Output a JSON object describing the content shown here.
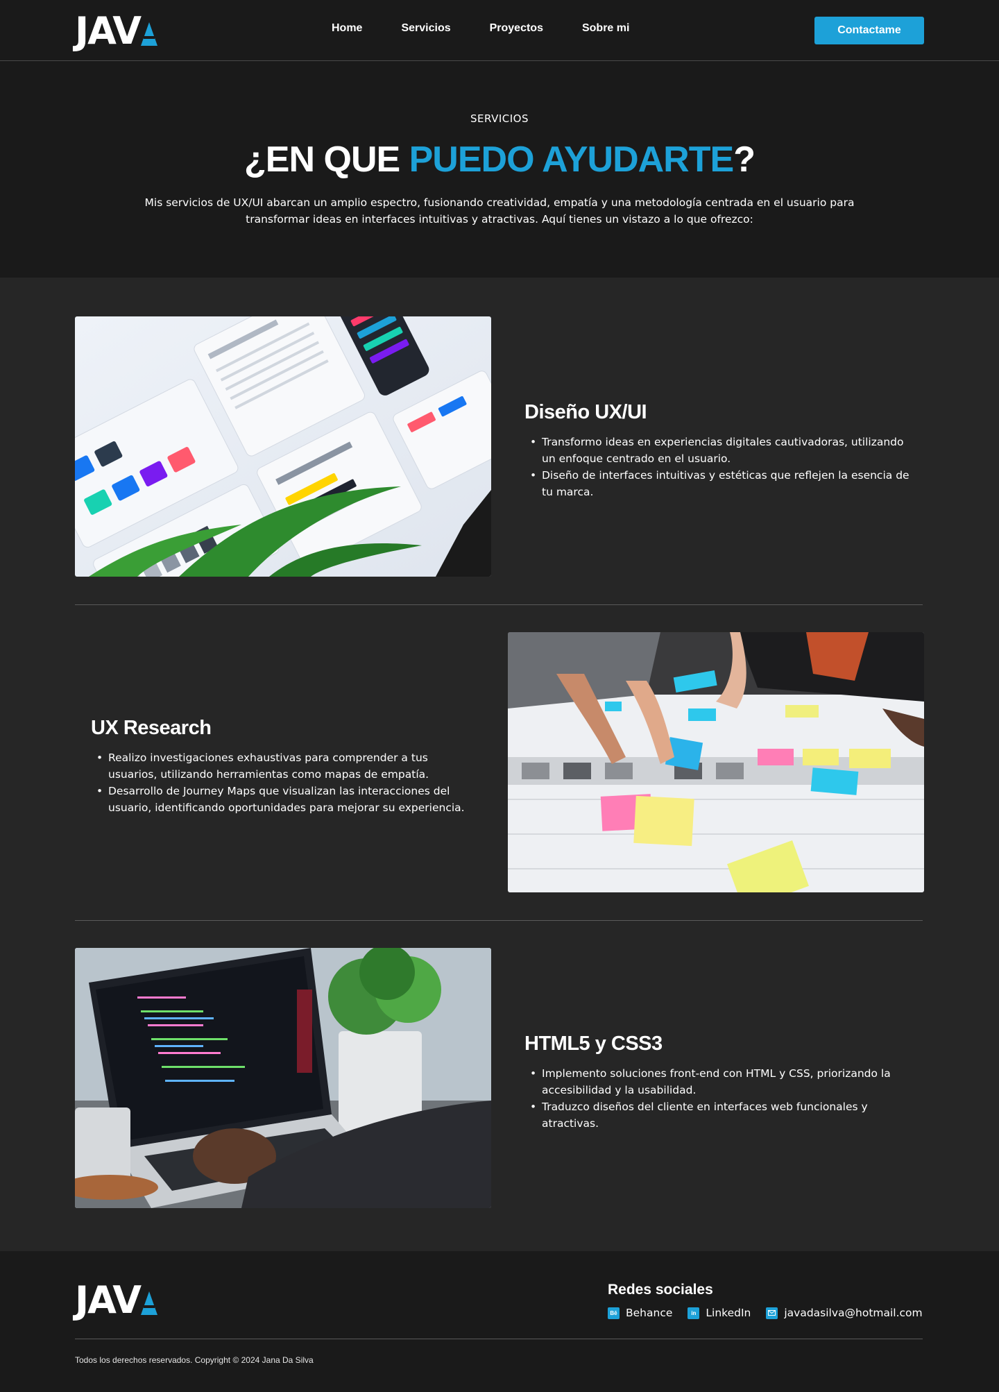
{
  "brand": {
    "logo_text": "JAV",
    "logo_mark": "triangle-a-icon",
    "accent_color": "#1da1d8"
  },
  "nav": {
    "items": [
      {
        "label": "Home"
      },
      {
        "label": "Servicios"
      },
      {
        "label": "Proyectos"
      },
      {
        "label": "Sobre mi"
      }
    ],
    "cta_label": "Contactame"
  },
  "hero": {
    "eyebrow": "SERVICIOS",
    "title_prefix": "¿EN QUE ",
    "title_accent": "PUEDO AYUDARTE",
    "title_suffix": "?",
    "description": "Mis servicios de UX/UI abarcan un amplio espectro, fusionando creatividad, empatía y una metodología centrada en el usuario para transformar ideas en interfaces intuitivas y atractivas. Aquí tienes un vistazo a lo que ofrezco:"
  },
  "services": [
    {
      "title": "Diseño UX/UI",
      "image": "ui-component-library-photo",
      "bullets": [
        "Transformo ideas en experiencias digitales cautivadoras, utilizando un enfoque centrado en el usuario.",
        "Diseño de interfaces intuitivas y estéticas que reflejen la esencia de tu marca."
      ]
    },
    {
      "title": "UX Research",
      "image": "journey-map-sticky-notes-photo",
      "bullets": [
        "Realizo investigaciones exhaustivas para comprender a tus usuarios, utilizando herramientas como mapas de empatía.",
        "Desarrollo de Journey Maps que visualizan las interacciones del usuario, identificando oportunidades para mejorar su experiencia."
      ]
    },
    {
      "title": "HTML5 y CSS3",
      "image": "laptop-code-editor-photo",
      "bullets": [
        "Implemento soluciones front-end con HTML y CSS, priorizando la accesibilidad y la usabilidad.",
        "Traduzco diseños del cliente en interfaces web funcionales y atractivas."
      ]
    }
  ],
  "footer": {
    "social_title": "Redes sociales",
    "links": [
      {
        "label": "Behance",
        "icon": "behance-icon"
      },
      {
        "label": "LinkedIn",
        "icon": "linkedin-icon"
      },
      {
        "label": "javadasilva@hotmail.com",
        "icon": "mail-icon"
      }
    ],
    "copyright": "Todos los derechos reservados. Copyright © 2024 Jana Da Silva"
  }
}
